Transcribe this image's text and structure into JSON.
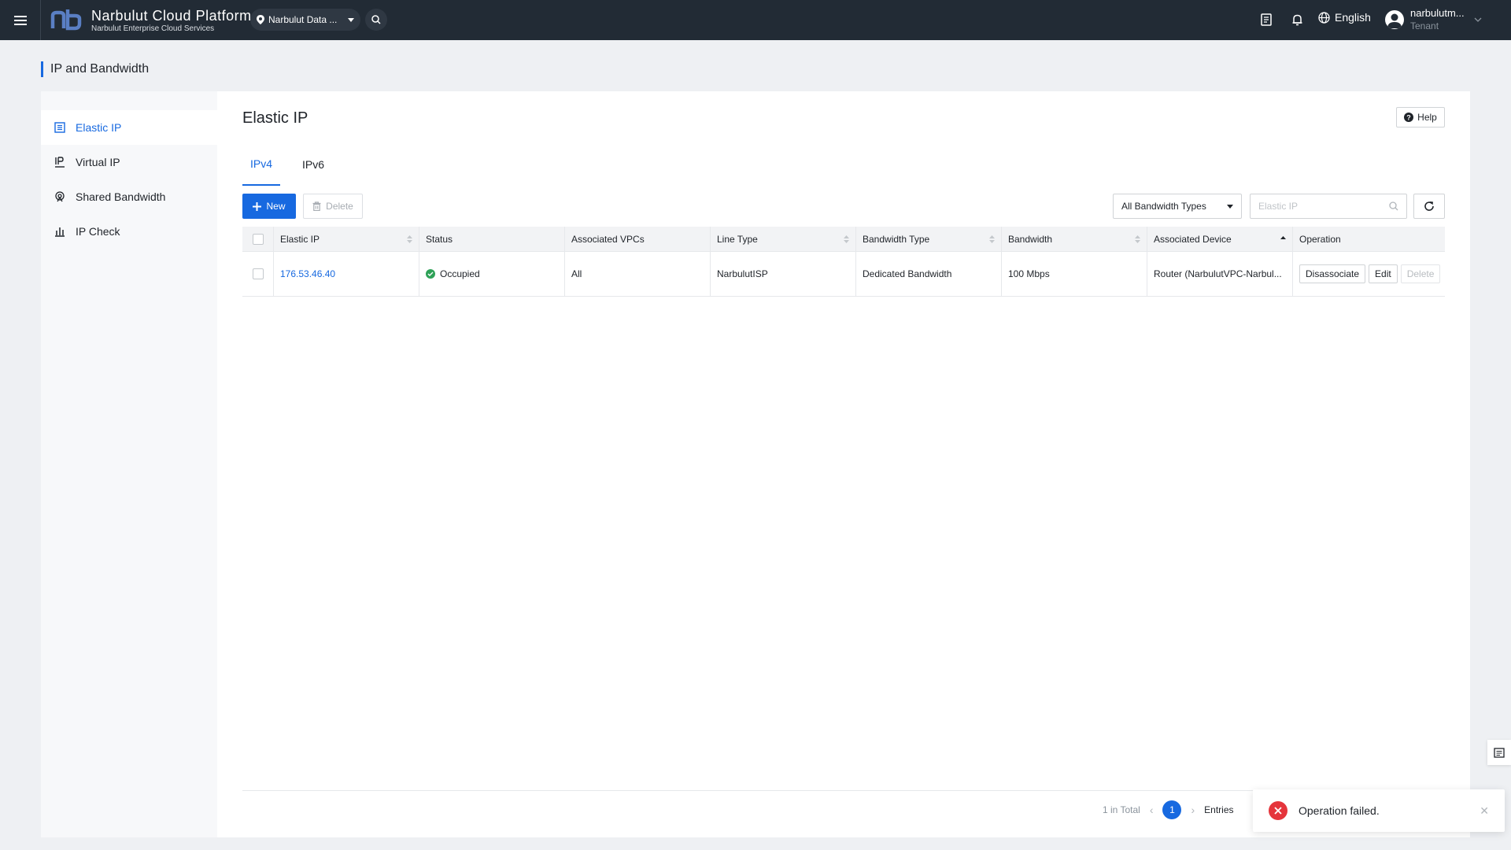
{
  "topbar": {
    "brand_title": "Narbulut Cloud Platform",
    "brand_subtitle": "Narbulut Enterprise Cloud Services",
    "region": "Narbulut Data ...",
    "language": "English",
    "user_name": "narbulutm...",
    "user_role": "Tenant"
  },
  "page": {
    "title": "IP and Bandwidth"
  },
  "sidebar": {
    "items": [
      {
        "label": "Elastic IP",
        "icon": "list-icon",
        "active": true
      },
      {
        "label": "Virtual IP",
        "icon": "ip-icon",
        "active": false
      },
      {
        "label": "Shared Bandwidth",
        "icon": "bandwidth-icon",
        "active": false
      },
      {
        "label": "IP Check",
        "icon": "bar-chart-icon",
        "active": false
      }
    ]
  },
  "main": {
    "heading": "Elastic IP",
    "help_label": "Help",
    "tabs": [
      {
        "label": "IPv4",
        "active": true
      },
      {
        "label": "IPv6",
        "active": false
      }
    ],
    "toolbar": {
      "new_label": "New",
      "delete_label": "Delete",
      "filter_value": "All Bandwidth Types",
      "search_placeholder": "Elastic IP"
    },
    "table": {
      "headers": [
        "Elastic IP",
        "Status",
        "Associated VPCs",
        "Line Type",
        "Bandwidth Type",
        "Bandwidth",
        "Associated Device",
        "Operation"
      ],
      "rows": [
        {
          "ip": "176.53.46.40",
          "status": "Occupied",
          "vpcs": "All",
          "line_type": "NarbulutISP",
          "bandwidth_type": "Dedicated Bandwidth",
          "bandwidth": "100 Mbps",
          "device": "Router (NarbulutVPC-Narbul...",
          "ops": [
            "Disassociate",
            "Edit",
            "Delete"
          ]
        }
      ]
    },
    "pagination": {
      "total": "1 in Total",
      "page": "1",
      "entries_label": "Entries"
    }
  },
  "toast": {
    "message": "Operation failed."
  },
  "colors": {
    "accent": "#1769e0",
    "topbar": "#222b35",
    "success": "#2ea157",
    "error": "#e5353c"
  }
}
